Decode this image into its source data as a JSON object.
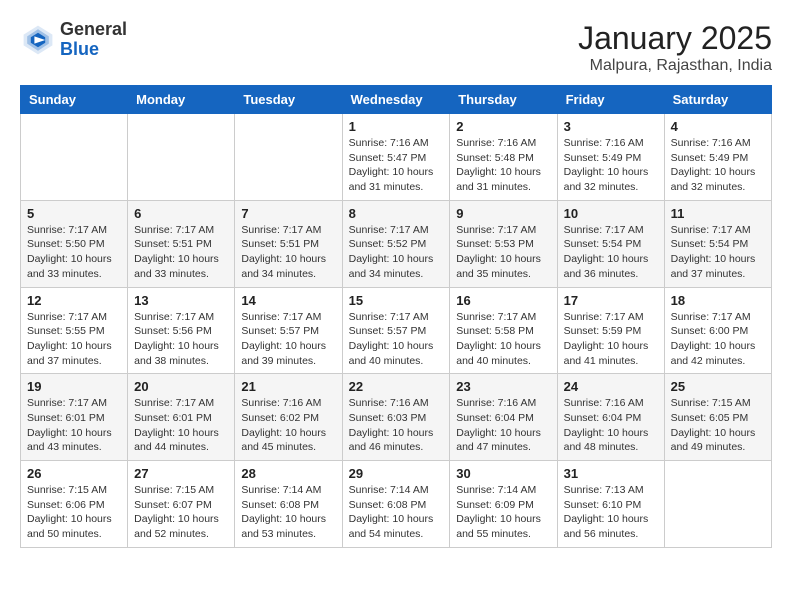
{
  "header": {
    "logo_line1": "General",
    "logo_line2": "Blue",
    "month": "January 2025",
    "location": "Malpura, Rajasthan, India"
  },
  "days_of_week": [
    "Sunday",
    "Monday",
    "Tuesday",
    "Wednesday",
    "Thursday",
    "Friday",
    "Saturday"
  ],
  "weeks": [
    [
      {
        "day": "",
        "info": ""
      },
      {
        "day": "",
        "info": ""
      },
      {
        "day": "",
        "info": ""
      },
      {
        "day": "1",
        "info": "Sunrise: 7:16 AM\nSunset: 5:47 PM\nDaylight: 10 hours\nand 31 minutes."
      },
      {
        "day": "2",
        "info": "Sunrise: 7:16 AM\nSunset: 5:48 PM\nDaylight: 10 hours\nand 31 minutes."
      },
      {
        "day": "3",
        "info": "Sunrise: 7:16 AM\nSunset: 5:49 PM\nDaylight: 10 hours\nand 32 minutes."
      },
      {
        "day": "4",
        "info": "Sunrise: 7:16 AM\nSunset: 5:49 PM\nDaylight: 10 hours\nand 32 minutes."
      }
    ],
    [
      {
        "day": "5",
        "info": "Sunrise: 7:17 AM\nSunset: 5:50 PM\nDaylight: 10 hours\nand 33 minutes."
      },
      {
        "day": "6",
        "info": "Sunrise: 7:17 AM\nSunset: 5:51 PM\nDaylight: 10 hours\nand 33 minutes."
      },
      {
        "day": "7",
        "info": "Sunrise: 7:17 AM\nSunset: 5:51 PM\nDaylight: 10 hours\nand 34 minutes."
      },
      {
        "day": "8",
        "info": "Sunrise: 7:17 AM\nSunset: 5:52 PM\nDaylight: 10 hours\nand 34 minutes."
      },
      {
        "day": "9",
        "info": "Sunrise: 7:17 AM\nSunset: 5:53 PM\nDaylight: 10 hours\nand 35 minutes."
      },
      {
        "day": "10",
        "info": "Sunrise: 7:17 AM\nSunset: 5:54 PM\nDaylight: 10 hours\nand 36 minutes."
      },
      {
        "day": "11",
        "info": "Sunrise: 7:17 AM\nSunset: 5:54 PM\nDaylight: 10 hours\nand 37 minutes."
      }
    ],
    [
      {
        "day": "12",
        "info": "Sunrise: 7:17 AM\nSunset: 5:55 PM\nDaylight: 10 hours\nand 37 minutes."
      },
      {
        "day": "13",
        "info": "Sunrise: 7:17 AM\nSunset: 5:56 PM\nDaylight: 10 hours\nand 38 minutes."
      },
      {
        "day": "14",
        "info": "Sunrise: 7:17 AM\nSunset: 5:57 PM\nDaylight: 10 hours\nand 39 minutes."
      },
      {
        "day": "15",
        "info": "Sunrise: 7:17 AM\nSunset: 5:57 PM\nDaylight: 10 hours\nand 40 minutes."
      },
      {
        "day": "16",
        "info": "Sunrise: 7:17 AM\nSunset: 5:58 PM\nDaylight: 10 hours\nand 40 minutes."
      },
      {
        "day": "17",
        "info": "Sunrise: 7:17 AM\nSunset: 5:59 PM\nDaylight: 10 hours\nand 41 minutes."
      },
      {
        "day": "18",
        "info": "Sunrise: 7:17 AM\nSunset: 6:00 PM\nDaylight: 10 hours\nand 42 minutes."
      }
    ],
    [
      {
        "day": "19",
        "info": "Sunrise: 7:17 AM\nSunset: 6:01 PM\nDaylight: 10 hours\nand 43 minutes."
      },
      {
        "day": "20",
        "info": "Sunrise: 7:17 AM\nSunset: 6:01 PM\nDaylight: 10 hours\nand 44 minutes."
      },
      {
        "day": "21",
        "info": "Sunrise: 7:16 AM\nSunset: 6:02 PM\nDaylight: 10 hours\nand 45 minutes."
      },
      {
        "day": "22",
        "info": "Sunrise: 7:16 AM\nSunset: 6:03 PM\nDaylight: 10 hours\nand 46 minutes."
      },
      {
        "day": "23",
        "info": "Sunrise: 7:16 AM\nSunset: 6:04 PM\nDaylight: 10 hours\nand 47 minutes."
      },
      {
        "day": "24",
        "info": "Sunrise: 7:16 AM\nSunset: 6:04 PM\nDaylight: 10 hours\nand 48 minutes."
      },
      {
        "day": "25",
        "info": "Sunrise: 7:15 AM\nSunset: 6:05 PM\nDaylight: 10 hours\nand 49 minutes."
      }
    ],
    [
      {
        "day": "26",
        "info": "Sunrise: 7:15 AM\nSunset: 6:06 PM\nDaylight: 10 hours\nand 50 minutes."
      },
      {
        "day": "27",
        "info": "Sunrise: 7:15 AM\nSunset: 6:07 PM\nDaylight: 10 hours\nand 52 minutes."
      },
      {
        "day": "28",
        "info": "Sunrise: 7:14 AM\nSunset: 6:08 PM\nDaylight: 10 hours\nand 53 minutes."
      },
      {
        "day": "29",
        "info": "Sunrise: 7:14 AM\nSunset: 6:08 PM\nDaylight: 10 hours\nand 54 minutes."
      },
      {
        "day": "30",
        "info": "Sunrise: 7:14 AM\nSunset: 6:09 PM\nDaylight: 10 hours\nand 55 minutes."
      },
      {
        "day": "31",
        "info": "Sunrise: 7:13 AM\nSunset: 6:10 PM\nDaylight: 10 hours\nand 56 minutes."
      },
      {
        "day": "",
        "info": ""
      }
    ]
  ]
}
